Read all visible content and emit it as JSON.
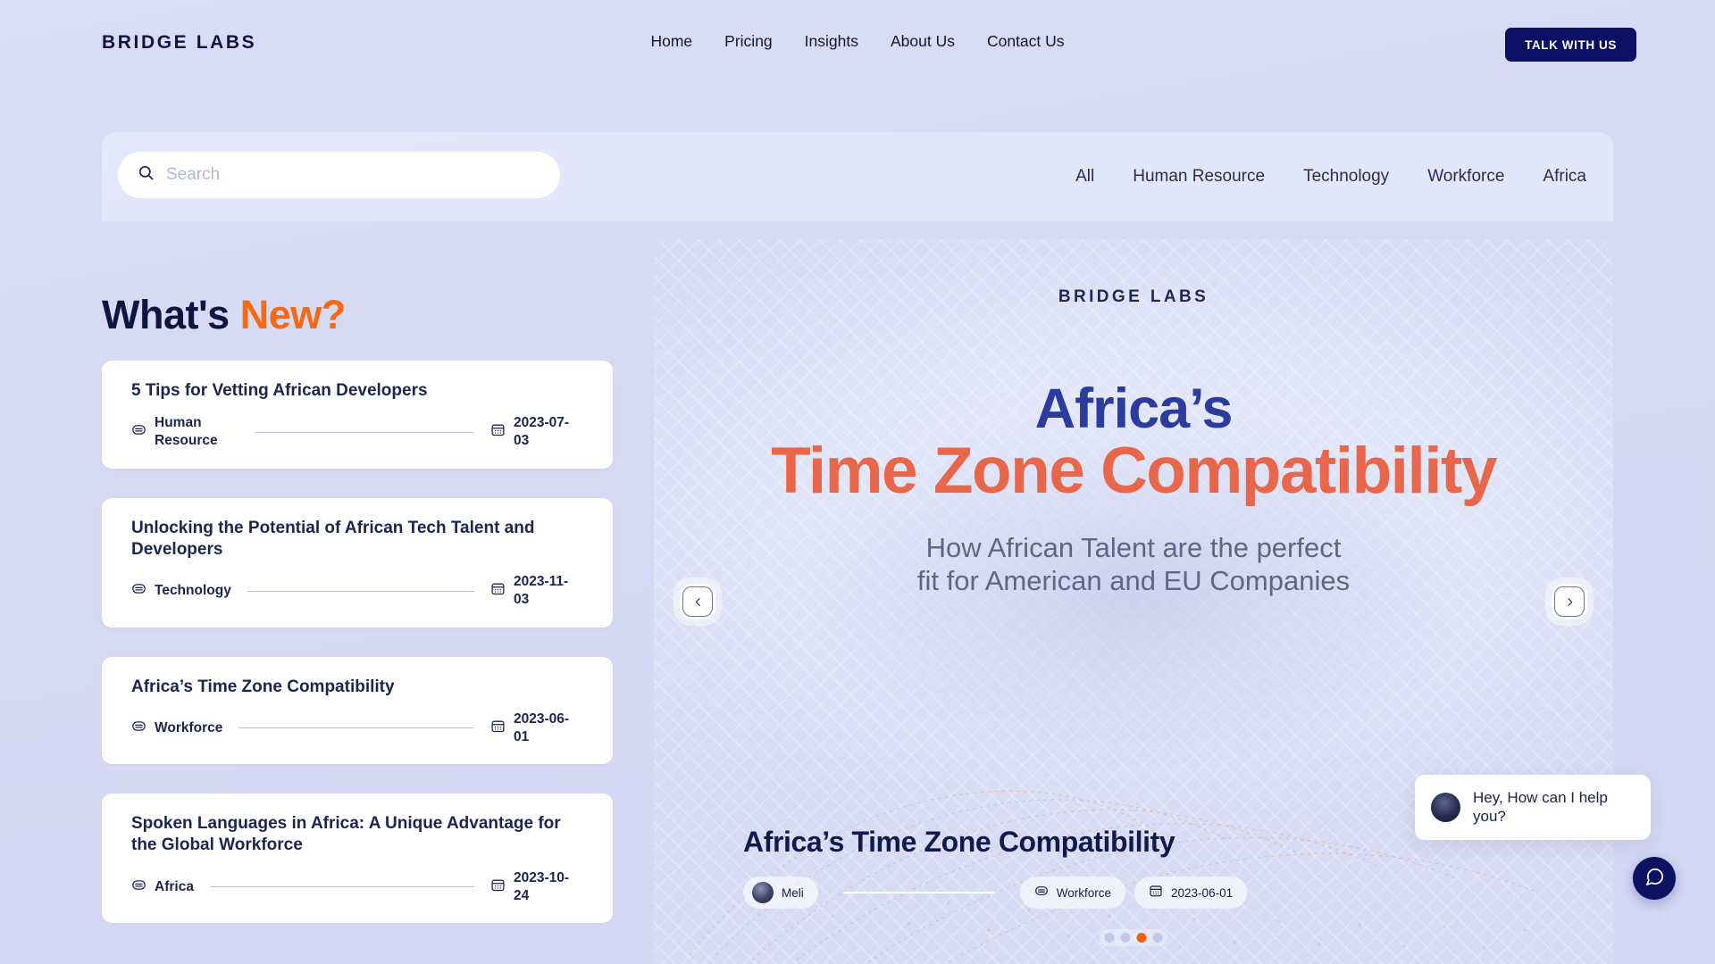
{
  "brand": {
    "logo_text": "BRIDGE LABS"
  },
  "nav": {
    "links": [
      {
        "label": "Home"
      },
      {
        "label": "Pricing"
      },
      {
        "label": "Insights"
      },
      {
        "label": "About Us"
      },
      {
        "label": "Contact Us"
      }
    ],
    "cta_label": "TALK WITH US"
  },
  "search": {
    "placeholder": "Search",
    "value": "",
    "icon": "search-icon"
  },
  "categories": [
    {
      "label": "All"
    },
    {
      "label": "Human Resource"
    },
    {
      "label": "Technology"
    },
    {
      "label": "Workforce"
    },
    {
      "label": "Africa"
    }
  ],
  "section": {
    "heading_part1": "What's ",
    "heading_part2": "New?"
  },
  "articles": [
    {
      "title": "5 Tips for Vetting African Developers",
      "category": "Human Resource",
      "date": "2023-07-03"
    },
    {
      "title": "Unlocking the Potential of African Tech Talent and Developers",
      "category": "Technology",
      "date": "2023-11-03"
    },
    {
      "title": "Africa’s Time Zone Compatibility",
      "category": "Workforce",
      "date": "2023-06-01"
    },
    {
      "title": "Spoken Languages in Africa: A Unique Advantage for the Global Workforce",
      "category": "Africa",
      "date": "2023-10-24"
    }
  ],
  "hero": {
    "logo_text": "BRIDGE LABS",
    "headline_line1": "Africa’s",
    "headline_line2": "Time Zone Compatibility",
    "subheadline_line1": "How African Talent are the perfect",
    "subheadline_line2": "fit for American and EU Companies",
    "caption": "Africa’s Time Zone Compatibility",
    "author": "Meli",
    "category": "Workforce",
    "date": "2023-06-01",
    "prev_label": "‹",
    "next_label": "›",
    "slides_total": 4,
    "active_slide": 3
  },
  "chat": {
    "message": "Hey, How can I help you?",
    "fab_icon": "chat-bubble-icon"
  },
  "colors": {
    "navy": "#0d1541",
    "cta_navy": "#0c1064",
    "orange": "#f96812",
    "hero_blue": "#2b3c9c",
    "hero_coral": "#e8674b",
    "page_bg": "#d8dcf5"
  }
}
